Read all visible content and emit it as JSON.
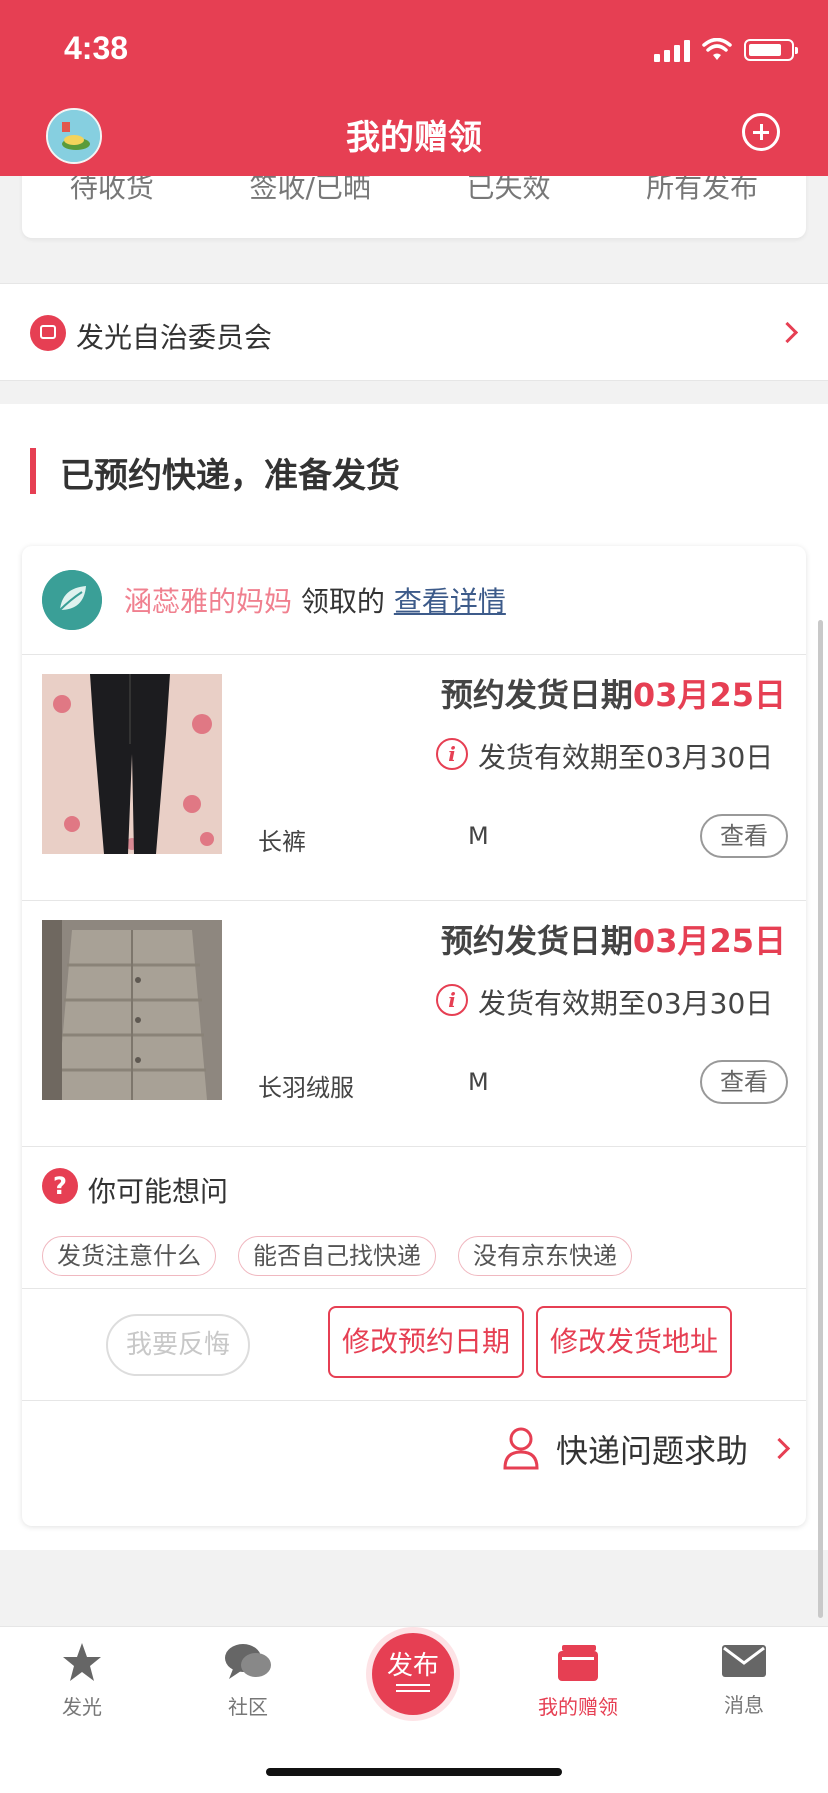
{
  "status_bar": {
    "time": "4:38"
  },
  "header": {
    "title": "我的赠领"
  },
  "filter_tabs": [
    "待收货",
    "签收/已晒",
    "已失效",
    "所有发布"
  ],
  "committee": {
    "label": "发光自治委员会"
  },
  "section": {
    "title": "已预约快递，准备发货"
  },
  "order": {
    "claimer_name": "涵蕊雅的妈妈",
    "claimer_verb": "领取的",
    "detail_link": "查看详情",
    "items": [
      {
        "date_label": "预约发货日期",
        "date_value": "03月25日",
        "valid_text": "发货有效期至03月30日",
        "name": "长裤",
        "size": "M",
        "view_label": "查看"
      },
      {
        "date_label": "预约发货日期",
        "date_value": "03月25日",
        "valid_text": "发货有效期至03月30日",
        "name": "长羽绒服",
        "size": "M",
        "view_label": "查看"
      }
    ],
    "faq": {
      "title": "你可能想问",
      "chips": [
        "发货注意什么",
        "能否自己找快递",
        "没有京东快递"
      ]
    },
    "actions": {
      "regret": "我要反悔",
      "change_date": "修改预约日期",
      "change_address": "修改发货地址"
    },
    "help_label": "快递问题求助"
  },
  "tabbar": {
    "tabs": [
      {
        "label": "发光",
        "icon": "star-icon"
      },
      {
        "label": "社区",
        "icon": "chat-bubbles-icon"
      },
      {
        "label": "发布",
        "icon": "publish-icon"
      },
      {
        "label": "我的赠领",
        "icon": "gift-box-icon",
        "active": true
      },
      {
        "label": "消息",
        "icon": "envelope-icon"
      }
    ]
  },
  "colors": {
    "brand": "#e63f53",
    "link": "#3d5b8a",
    "claimer_name": "#f0808f"
  }
}
